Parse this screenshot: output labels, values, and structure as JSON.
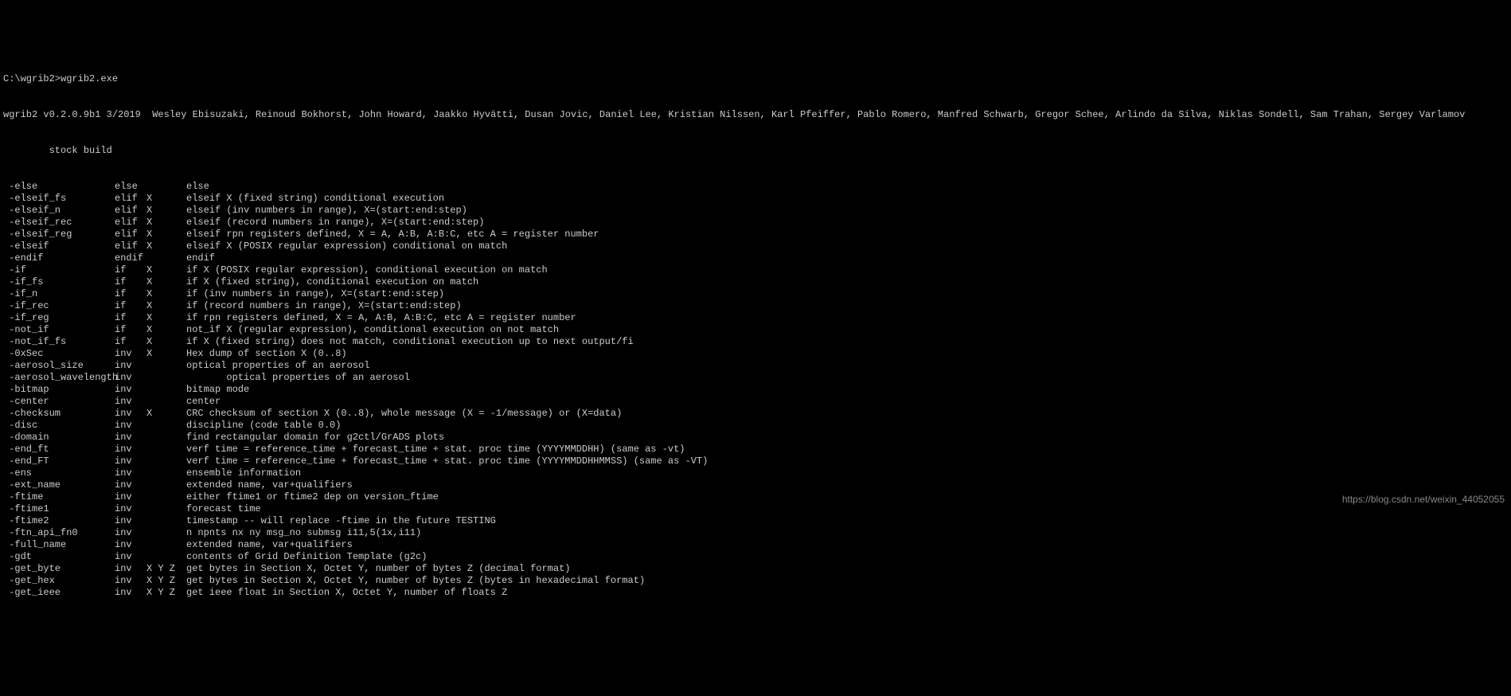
{
  "prompt": "C:\\wgrib2>wgrib2.exe",
  "version_line": "wgrib2 v0.2.0.9b1 3/2019  Wesley Ebisuzaki, Reinoud Bokhorst, John Howard, Jaakko Hyvätti, Dusan Jovic, Daniel Lee, Kristian Nilssen, Karl Pfeiffer, Pablo Romero, Manfred Schwarb, Gregor Schee, Arlindo da Silva, Niklas Sondell, Sam Trahan, Sergey Varlamov",
  "build_line": "        stock build",
  "watermark": "https://blog.csdn.net/weixin_44052055",
  "rows": [
    {
      "opt": " -else",
      "type": "else",
      "arg": "",
      "desc": "else"
    },
    {
      "opt": " -elseif_fs",
      "type": "elif",
      "arg": "X",
      "desc": "elseif X (fixed string) conditional execution"
    },
    {
      "opt": " -elseif_n",
      "type": "elif",
      "arg": "X",
      "desc": "elseif (inv numbers in range), X=(start:end:step)"
    },
    {
      "opt": " -elseif_rec",
      "type": "elif",
      "arg": "X",
      "desc": "elseif (record numbers in range), X=(start:end:step)"
    },
    {
      "opt": " -elseif_reg",
      "type": "elif",
      "arg": "X",
      "desc": "elseif rpn registers defined, X = A, A:B, A:B:C, etc A = register number"
    },
    {
      "opt": " -elseif",
      "type": "elif",
      "arg": "X",
      "desc": "elseif X (POSIX regular expression) conditional on match"
    },
    {
      "opt": " -endif",
      "type": "endif",
      "arg": "",
      "desc": "endif"
    },
    {
      "opt": " -if",
      "type": "if",
      "arg": "X",
      "desc": "if X (POSIX regular expression), conditional execution on match"
    },
    {
      "opt": " -if_fs",
      "type": "if",
      "arg": "X",
      "desc": "if X (fixed string), conditional execution on match"
    },
    {
      "opt": " -if_n",
      "type": "if",
      "arg": "X",
      "desc": "if (inv numbers in range), X=(start:end:step)"
    },
    {
      "opt": " -if_rec",
      "type": "if",
      "arg": "X",
      "desc": "if (record numbers in range), X=(start:end:step)"
    },
    {
      "opt": " -if_reg",
      "type": "if",
      "arg": "X",
      "desc": "if rpn registers defined, X = A, A:B, A:B:C, etc A = register number"
    },
    {
      "opt": " -not_if",
      "type": "if",
      "arg": "X",
      "desc": "not_if X (regular expression), conditional execution on not match"
    },
    {
      "opt": " -not_if_fs",
      "type": "if",
      "arg": "X",
      "desc": "if X (fixed string) does not match, conditional execution up to next output/fi"
    },
    {
      "opt": " -0xSec",
      "type": "inv",
      "arg": "X",
      "desc": "Hex dump of section X (0..8)"
    },
    {
      "opt": " -aerosol_size",
      "type": "inv",
      "arg": "",
      "desc": "optical properties of an aerosol"
    },
    {
      "opt": " -aerosol_wavelength",
      "type": "inv",
      "arg": "",
      "desc": "       optical properties of an aerosol"
    },
    {
      "opt": " -bitmap",
      "type": "inv",
      "arg": "",
      "desc": "bitmap mode"
    },
    {
      "opt": " -center",
      "type": "inv",
      "arg": "",
      "desc": "center"
    },
    {
      "opt": " -checksum",
      "type": "inv",
      "arg": "X",
      "desc": "CRC checksum of section X (0..8), whole message (X = -1/message) or (X=data)"
    },
    {
      "opt": " -disc",
      "type": "inv",
      "arg": "",
      "desc": "discipline (code table 0.0)"
    },
    {
      "opt": " -domain",
      "type": "inv",
      "arg": "",
      "desc": "find rectangular domain for g2ctl/GrADS plots"
    },
    {
      "opt": " -end_ft",
      "type": "inv",
      "arg": "",
      "desc": "verf time = reference_time + forecast_time + stat. proc time (YYYYMMDDHH) (same as -vt)"
    },
    {
      "opt": " -end_FT",
      "type": "inv",
      "arg": "",
      "desc": "verf time = reference_time + forecast_time + stat. proc time (YYYYMMDDHHMMSS) (same as -VT)"
    },
    {
      "opt": " -ens",
      "type": "inv",
      "arg": "",
      "desc": "ensemble information"
    },
    {
      "opt": " -ext_name",
      "type": "inv",
      "arg": "",
      "desc": "extended name, var+qualifiers"
    },
    {
      "opt": " -ftime",
      "type": "inv",
      "arg": "",
      "desc": "either ftime1 or ftime2 dep on version_ftime"
    },
    {
      "opt": " -ftime1",
      "type": "inv",
      "arg": "",
      "desc": "forecast time"
    },
    {
      "opt": " -ftime2",
      "type": "inv",
      "arg": "",
      "desc": "timestamp -- will replace -ftime in the future TESTING"
    },
    {
      "opt": " -ftn_api_fn0",
      "type": "inv",
      "arg": "",
      "desc": "n npnts nx ny msg_no submsg i11,5(1x,i11)"
    },
    {
      "opt": " -full_name",
      "type": "inv",
      "arg": "",
      "desc": "extended name, var+qualifiers"
    },
    {
      "opt": " -gdt",
      "type": "inv",
      "arg": "",
      "desc": "contents of Grid Definition Template (g2c)"
    },
    {
      "opt": " -get_byte",
      "type": "inv",
      "arg": "X Y Z",
      "desc": "get bytes in Section X, Octet Y, number of bytes Z (decimal format)"
    },
    {
      "opt": " -get_hex",
      "type": "inv",
      "arg": "X Y Z",
      "desc": "get bytes in Section X, Octet Y, number of bytes Z (bytes in hexadecimal format)"
    },
    {
      "opt": " -get_ieee",
      "type": "inv",
      "arg": "X Y Z",
      "desc": "get ieee float in Section X, Octet Y, number of floats Z"
    }
  ]
}
